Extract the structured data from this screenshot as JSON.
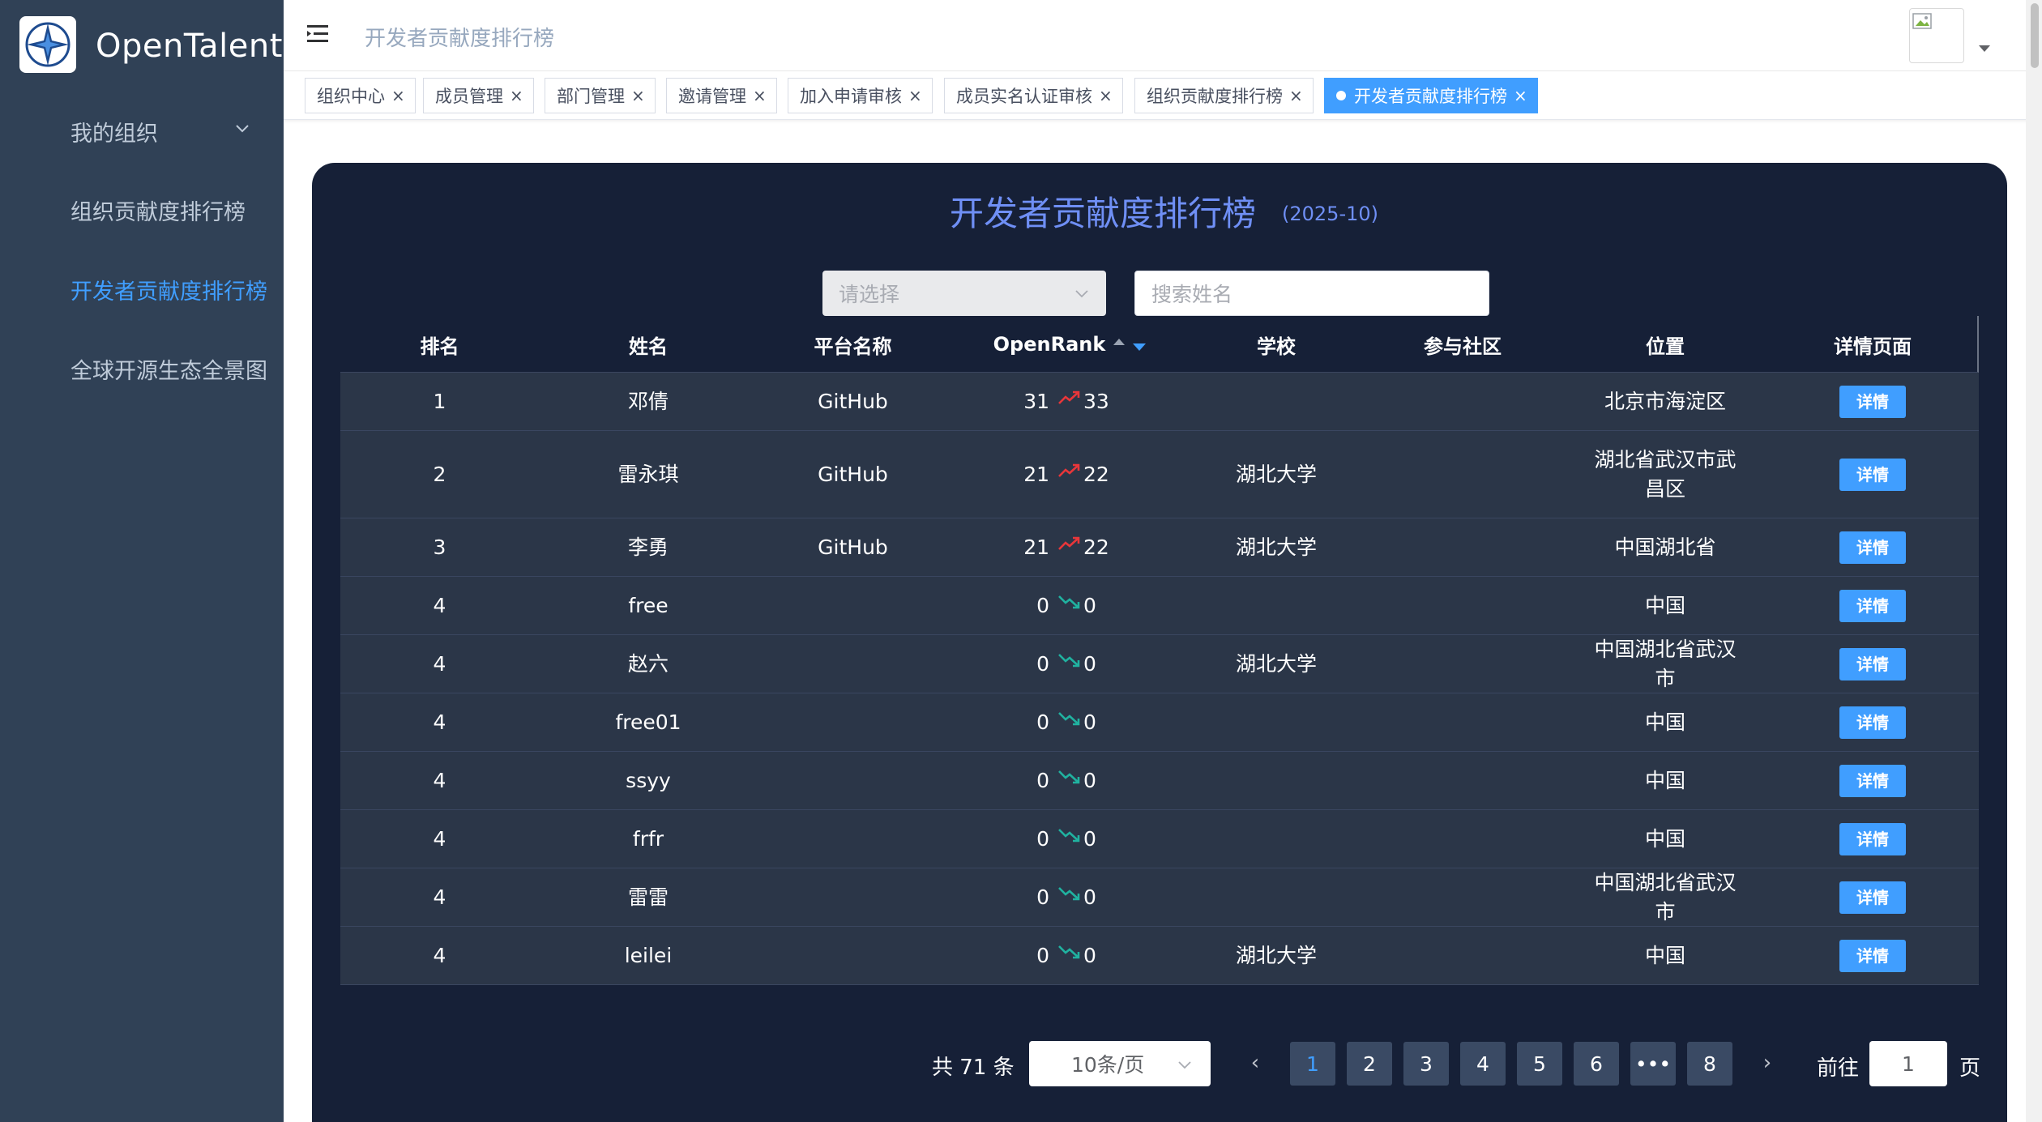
{
  "app": {
    "title": "OpenTalent"
  },
  "sidebar": {
    "items": [
      {
        "label": "我的组织"
      },
      {
        "label": "组织贡献度排行榜"
      },
      {
        "label": "开发者贡献度排行榜"
      },
      {
        "label": "全球开源生态全景图"
      }
    ]
  },
  "header": {
    "breadcrumb": "开发者贡献度排行榜"
  },
  "tags": [
    {
      "label": "组织中心"
    },
    {
      "label": "成员管理"
    },
    {
      "label": "部门管理"
    },
    {
      "label": "邀请管理"
    },
    {
      "label": "加入申请审核"
    },
    {
      "label": "成员实名认证审核"
    },
    {
      "label": "组织贡献度排行榜"
    },
    {
      "label": "开发者贡献度排行榜"
    }
  ],
  "main": {
    "title": "开发者贡献度排行榜",
    "period": "(2025-10)",
    "select_placeholder": "请选择",
    "search_placeholder": "搜索姓名"
  },
  "table": {
    "columns": [
      "排名",
      "姓名",
      "平台名称",
      "OpenRank",
      "学校",
      "参与社区",
      "位置",
      "详情页面"
    ],
    "detail_label": "详情",
    "rows": [
      {
        "rank": "1",
        "name": "邓倩",
        "platform": "GitHub",
        "or_prev": "31",
        "or_curr": "33",
        "trend": "up",
        "school": "",
        "community": "",
        "location": "北京市海淀区"
      },
      {
        "rank": "2",
        "name": "雷永琪",
        "platform": "GitHub",
        "or_prev": "21",
        "or_curr": "22",
        "trend": "up",
        "school": "湖北大学",
        "community": "",
        "location": "湖北省武汉市武昌区"
      },
      {
        "rank": "3",
        "name": "李勇",
        "platform": "GitHub",
        "or_prev": "21",
        "or_curr": "22",
        "trend": "up",
        "school": "湖北大学",
        "community": "",
        "location": "中国湖北省"
      },
      {
        "rank": "4",
        "name": "free",
        "platform": "",
        "or_prev": "0",
        "or_curr": "0",
        "trend": "down",
        "school": "",
        "community": "",
        "location": "中国"
      },
      {
        "rank": "4",
        "name": "赵六",
        "platform": "",
        "or_prev": "0",
        "or_curr": "0",
        "trend": "down",
        "school": "湖北大学",
        "community": "",
        "location": "中国湖北省武汉市"
      },
      {
        "rank": "4",
        "name": "free01",
        "platform": "",
        "or_prev": "0",
        "or_curr": "0",
        "trend": "down",
        "school": "",
        "community": "",
        "location": "中国"
      },
      {
        "rank": "4",
        "name": "ssyy",
        "platform": "",
        "or_prev": "0",
        "or_curr": "0",
        "trend": "down",
        "school": "",
        "community": "",
        "location": "中国"
      },
      {
        "rank": "4",
        "name": "frfr",
        "platform": "",
        "or_prev": "0",
        "or_curr": "0",
        "trend": "down",
        "school": "",
        "community": "",
        "location": "中国"
      },
      {
        "rank": "4",
        "name": "雷雷",
        "platform": "",
        "or_prev": "0",
        "or_curr": "0",
        "trend": "down",
        "school": "",
        "community": "",
        "location": "中国湖北省武汉市"
      },
      {
        "rank": "4",
        "name": "leilei",
        "platform": "",
        "or_prev": "0",
        "or_curr": "0",
        "trend": "down",
        "school": "湖北大学",
        "community": "",
        "location": "中国"
      }
    ]
  },
  "pagination": {
    "total_label": "共 71 条",
    "page_size": "10条/页",
    "pages": [
      "1",
      "2",
      "3",
      "4",
      "5",
      "6",
      "•••",
      "8"
    ],
    "current_page": "1",
    "goto_label": "前往",
    "goto_value": "1",
    "page_suffix": "页"
  },
  "colors": {
    "sidebar_bg": "#304156",
    "accent": "#409eff",
    "card_bg": "#162037",
    "trend_up": "#e8363a",
    "trend_down": "#20b2a0"
  }
}
